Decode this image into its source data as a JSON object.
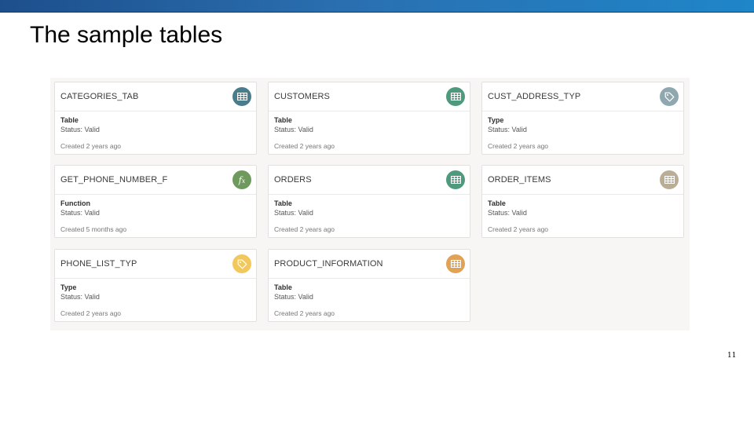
{
  "slide": {
    "title": "The sample tables",
    "page_number": "11"
  },
  "colors": {
    "top_bar": "#2a6fb0",
    "table_teal": "#4a7d8c",
    "table_green": "#4e9a7c",
    "type_gray": "#8fa8b0",
    "function_green": "#6f9a5e",
    "table_tan": "#b9ad95",
    "type_yellow": "#f2c75c",
    "table_orange": "#e1a255"
  },
  "cards": [
    {
      "name": "CATEGORIES_TAB",
      "type": "Table",
      "status": "Status: Valid",
      "created": "Created 2 years ago",
      "icon": "table-icon",
      "icon_color": "#4a7d8c"
    },
    {
      "name": "CUSTOMERS",
      "type": "Table",
      "status": "Status: Valid",
      "created": "Created 2 years ago",
      "icon": "table-icon",
      "icon_color": "#4e9a7c"
    },
    {
      "name": "CUST_ADDRESS_TYP",
      "type": "Type",
      "status": "Status: Valid",
      "created": "Created 2 years ago",
      "icon": "tag-icon",
      "icon_color": "#8fa8b0"
    },
    {
      "name": "GET_PHONE_NUMBER_F",
      "type": "Function",
      "status": "Status: Valid",
      "created": "Created 5 months ago",
      "icon": "function-icon",
      "icon_color": "#6f9a5e"
    },
    {
      "name": "ORDERS",
      "type": "Table",
      "status": "Status: Valid",
      "created": "Created 2 years ago",
      "icon": "table-icon",
      "icon_color": "#4e9a7c"
    },
    {
      "name": "ORDER_ITEMS",
      "type": "Table",
      "status": "Status: Valid",
      "created": "Created 2 years ago",
      "icon": "table-icon",
      "icon_color": "#b9ad95"
    },
    {
      "name": "PHONE_LIST_TYP",
      "type": "Type",
      "status": "Status: Valid",
      "created": "Created 2 years ago",
      "icon": "tag-icon",
      "icon_color": "#f2c75c"
    },
    {
      "name": "PRODUCT_INFORMATION",
      "type": "Table",
      "status": "Status: Valid",
      "created": "Created 2 years ago",
      "icon": "table-icon",
      "icon_color": "#e1a255"
    }
  ]
}
